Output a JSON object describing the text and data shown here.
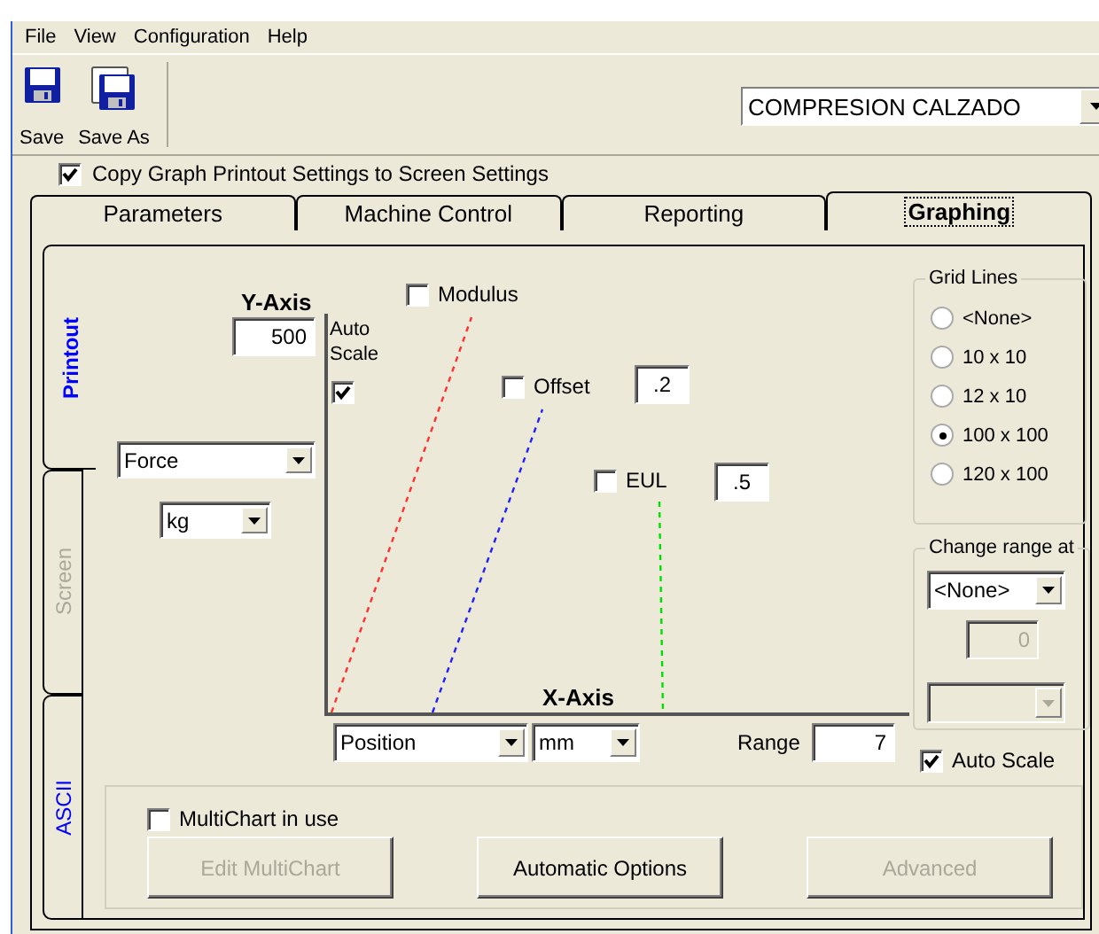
{
  "menu": [
    "File",
    "View",
    "Configuration",
    "Help"
  ],
  "toolbar": [
    {
      "label": "Save",
      "kind": "save"
    },
    {
      "label": "Save As",
      "kind": "save_as"
    }
  ],
  "method_select": {
    "value": "COMPRESION CALZADO"
  },
  "copy_settings": {
    "label": "Copy Graph Printout Settings to Screen Settings",
    "checked": true
  },
  "tabs": [
    {
      "label": "Parameters",
      "selected": false
    },
    {
      "label": "Machine Control",
      "selected": false
    },
    {
      "label": "Reporting",
      "selected": false
    },
    {
      "label": "Graphing",
      "selected": true
    }
  ],
  "side_tabs": [
    {
      "label": "Printout",
      "selected": true,
      "disabled": false
    },
    {
      "label": "Screen",
      "selected": false,
      "disabled": true
    },
    {
      "label": "ASCII",
      "selected": false,
      "disabled": false
    }
  ],
  "y_axis": {
    "title": "Y-Axis",
    "max": "500",
    "auto_scale_label": "Auto Scale",
    "auto_scale": true,
    "quantity": "Force",
    "unit": "kg"
  },
  "curves": [
    {
      "label": "Modulus",
      "checked": false,
      "color": "#ff3030"
    },
    {
      "label": "Offset",
      "checked": false,
      "value": ".2",
      "color": "#2020ff"
    },
    {
      "label": "EUL",
      "checked": false,
      "value": ".5",
      "color": "#00e000"
    }
  ],
  "x_axis": {
    "title": "X-Axis",
    "quantity": "Position",
    "unit": "mm",
    "range_label": "Range",
    "range": "7"
  },
  "grid_lines": {
    "title": "Grid Lines",
    "options": [
      {
        "label": "<None>",
        "selected": false
      },
      {
        "label": "10 x 10",
        "selected": false
      },
      {
        "label": "12 x 10",
        "selected": false
      },
      {
        "label": "100 x 100",
        "selected": true
      },
      {
        "label": "120 x 100",
        "selected": false
      }
    ]
  },
  "change_range": {
    "title": "Change range at",
    "value": "<None>",
    "threshold": "0",
    "threshold_disabled": true,
    "second_select_disabled": true
  },
  "auto_scale": {
    "label": "Auto Scale",
    "checked": true
  },
  "multichart": {
    "label": "MultiChart in use",
    "checked": false
  },
  "buttons": [
    {
      "label": "Edit MultiChart",
      "disabled": true
    },
    {
      "label": "Automatic Options",
      "disabled": false
    },
    {
      "label": "Advanced",
      "disabled": true
    }
  ]
}
